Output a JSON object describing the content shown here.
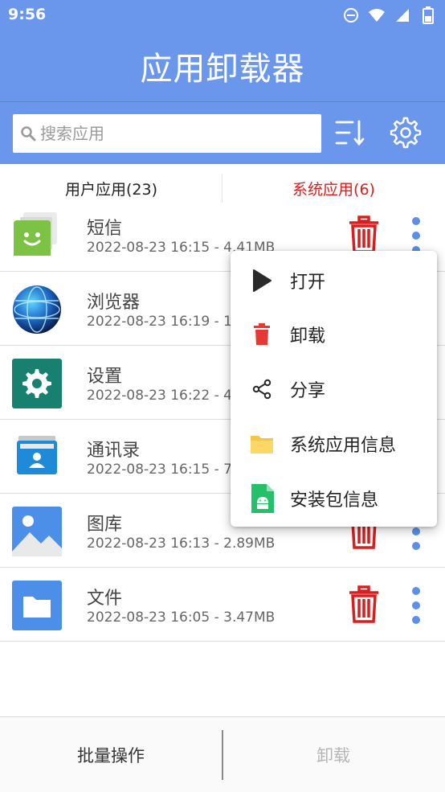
{
  "status": {
    "time": "9:56",
    "icons": [
      "do-not-disturb-icon",
      "wifi-icon",
      "signal-icon",
      "battery-icon"
    ]
  },
  "app": {
    "title": "应用卸载器"
  },
  "search": {
    "placeholder": "搜索应用",
    "value": ""
  },
  "toolbar": {
    "sort_icon": "sort-icon",
    "settings_icon": "gear-icon"
  },
  "tabs": [
    {
      "label": "用户应用(23)",
      "selected": false
    },
    {
      "label": "系统应用(6)",
      "selected": true
    }
  ],
  "apps": [
    {
      "name": "短信",
      "meta": "2022-08-23 16:15 - 4.41MB",
      "icon": "messages-icon"
    },
    {
      "name": "浏览器",
      "meta": "2022-08-23 16:19 - 1.9",
      "icon": "browser-icon"
    },
    {
      "name": "设置",
      "meta": "2022-08-23 16:22 - 46",
      "icon": "settings-app-icon"
    },
    {
      "name": "通讯录",
      "meta": "2022-08-23 16:15 - 7.6",
      "icon": "contacts-icon"
    },
    {
      "name": "图库",
      "meta": "2022-08-23 16:13 - 2.89MB",
      "icon": "gallery-icon"
    },
    {
      "name": "文件",
      "meta": "2022-08-23 16:05 - 3.47MB",
      "icon": "files-icon"
    }
  ],
  "context_menu": [
    {
      "label": "打开",
      "icon": "play-icon"
    },
    {
      "label": "卸载",
      "icon": "trash-icon"
    },
    {
      "label": "分享",
      "icon": "share-icon"
    },
    {
      "label": "系统应用信息",
      "icon": "folder-icon"
    },
    {
      "label": "安装包信息",
      "icon": "apk-file-icon"
    }
  ],
  "bottom": {
    "batch_label": "批量操作",
    "uninstall_label": "卸载"
  },
  "colors": {
    "primary": "#6a97ec",
    "danger": "#d81e1e",
    "accent_dots": "#5b8fe8"
  }
}
